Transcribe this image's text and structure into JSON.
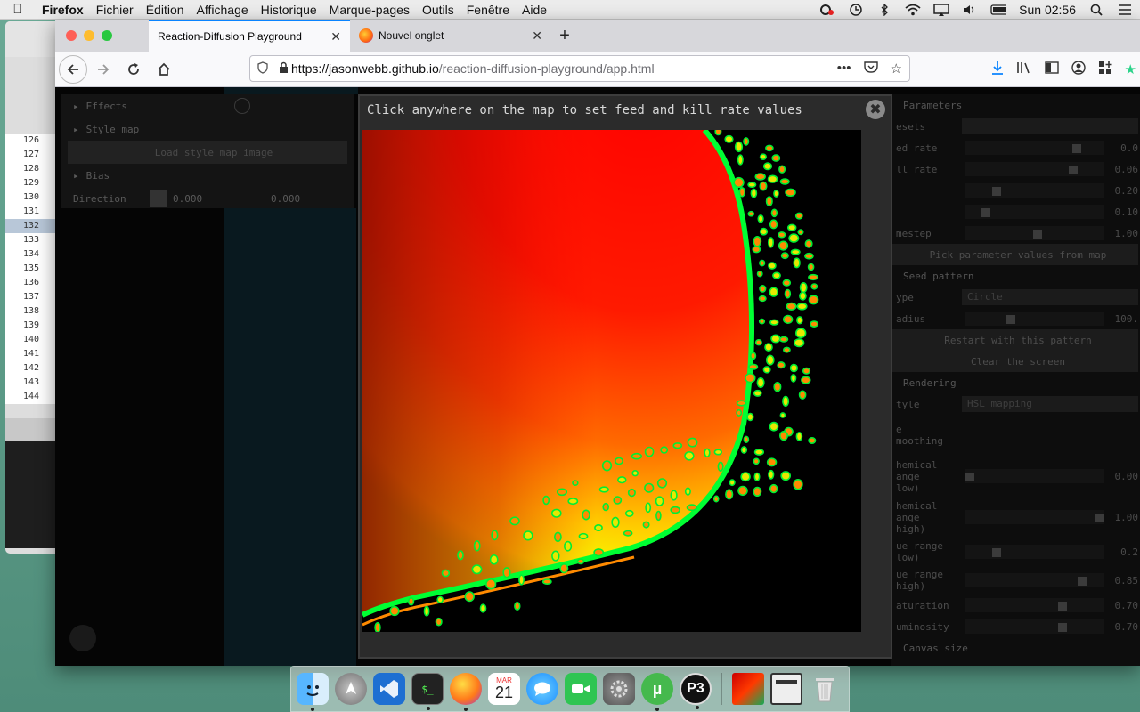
{
  "menubar": {
    "apple": "",
    "items": [
      "Firefox",
      "Fichier",
      "Édition",
      "Affichage",
      "Historique",
      "Marque-pages",
      "Outils",
      "Fenêtre",
      "Aide"
    ],
    "clock": "Sun 02:56"
  },
  "editor": {
    "line_numbers": [
      "126",
      "127",
      "128",
      "129",
      "130",
      "131",
      "132",
      "133",
      "134",
      "135",
      "136",
      "137",
      "138",
      "139",
      "140",
      "141",
      "142",
      "143",
      "144"
    ],
    "highlighted_line": "132"
  },
  "browser": {
    "tabs": [
      {
        "label": "Reaction-Diffusion Playground"
      },
      {
        "label": "Nouvel onglet"
      }
    ],
    "url": {
      "host": "https://jasonwebb.github.io",
      "path": "/reaction-diffusion-playground/app.html"
    }
  },
  "left_panel": {
    "effects": "Effects",
    "style_map": "Style map",
    "load_button": "Load style map image",
    "bias": "Bias",
    "direction_label": "Direction",
    "direction_x": "0.000",
    "direction_y": "0.000"
  },
  "right_panel": {
    "parameters": "Parameters",
    "presets": "esets",
    "feed_rate": "ed rate",
    "feed_rate_value": "0.0",
    "kill_rate": "ll rate",
    "kill_rate_value": "0.06",
    "da_value": "0.20",
    "db_value": "0.10",
    "timestep": "mestep",
    "timestep_value": "1.00",
    "pick_button": "Pick parameter values from map",
    "seed_pattern": "Seed pattern",
    "type_label": "ype",
    "type_value": "Circle",
    "radius_label": "adius",
    "radius_value": "100.",
    "restart_button": "Restart with this pattern",
    "clear_button": "Clear the screen",
    "rendering": "Rendering",
    "style_label": "tyle",
    "style_value": "HSL mapping",
    "smoothing_label": "e\nmoothing",
    "chem_low_label": "hemical\nange\nlow)",
    "chem_low_value": "0.00",
    "chem_high_label": "hemical\nange\nhigh)",
    "chem_high_value": "1.00",
    "hue_low_label": "ue range\nlow)",
    "hue_low_value": "0.2",
    "hue_high_label": "ue range\nhigh)",
    "hue_high_value": "0.85",
    "saturation_label": "aturation",
    "saturation_value": "0.70",
    "luminosity_label": "uminosity",
    "luminosity_value": "0.70",
    "canvas_size": "Canvas size"
  },
  "modal": {
    "title": "Click anywhere on the map to set feed and kill rate values",
    "close": "✖"
  },
  "dock": {
    "icons": [
      "finder-icon",
      "launchpad-icon",
      "vscode-icon",
      "terminal-icon",
      "firefox-icon",
      "calendar-icon",
      "messages-icon",
      "facetime-icon",
      "system-preferences-icon",
      "utorrent-icon",
      "processing-icon",
      "reaction-diffusion-icon",
      "window-icon",
      "trash-icon"
    ],
    "calendar_month": "MAR",
    "calendar_day": "21"
  },
  "colors": {
    "accent": "#0a84ff",
    "map_red": "#ff0000",
    "map_yellow": "#ffff00",
    "map_green": "#00ff33"
  }
}
